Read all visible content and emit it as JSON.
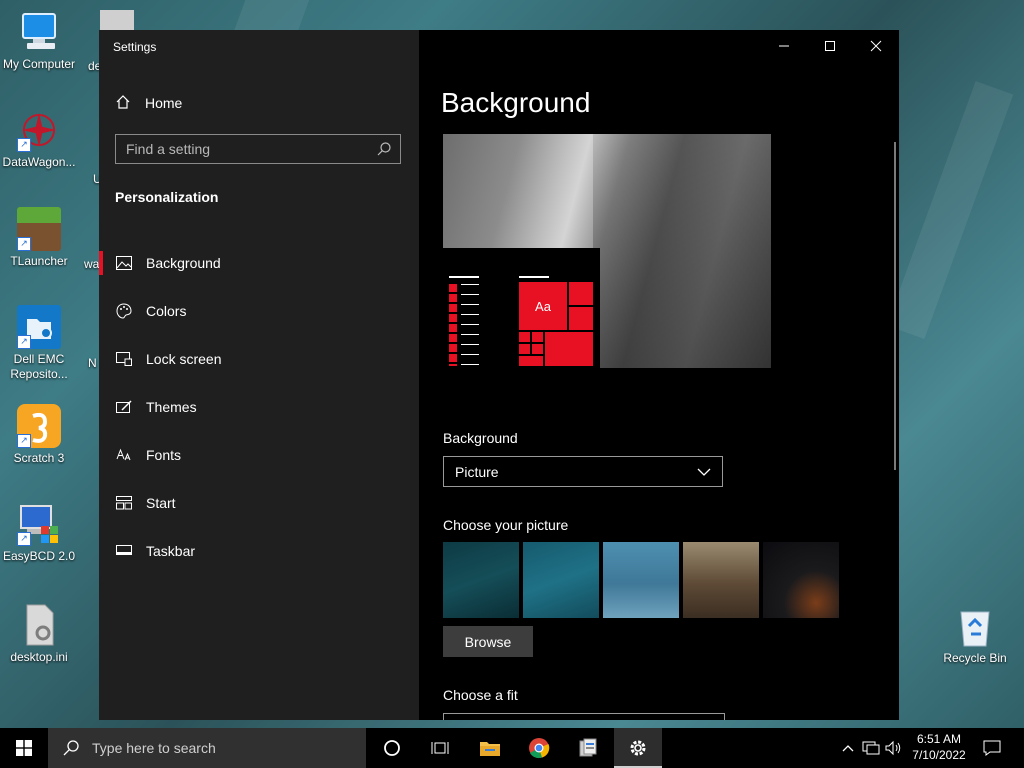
{
  "desktop": {
    "icons": [
      {
        "label_line1": "My Computer",
        "label_line2": ""
      },
      {
        "label_line1": "DataWagon...",
        "label_line2": ""
      },
      {
        "label_line1": "TLauncher",
        "label_line2": ""
      },
      {
        "label_line1": "Dell EMC",
        "label_line2": "Reposito..."
      },
      {
        "label_line1": "Scratch 3",
        "label_line2": ""
      },
      {
        "label_line1": "EasyBCD 2.0",
        "label_line2": ""
      },
      {
        "label_line1": "desktop.ini",
        "label_line2": ""
      },
      {
        "label_line1": "Recycle Bin",
        "label_line2": ""
      }
    ],
    "partial_labels": [
      "de",
      "U",
      "wa",
      "N"
    ]
  },
  "window": {
    "title": "Settings",
    "home_label": "Home",
    "search_placeholder": "Find a setting",
    "section": "Personalization",
    "nav": [
      {
        "label": "Background",
        "icon": "picture-icon"
      },
      {
        "label": "Colors",
        "icon": "palette-icon"
      },
      {
        "label": "Lock screen",
        "icon": "lock-screen-icon"
      },
      {
        "label": "Themes",
        "icon": "brush-icon"
      },
      {
        "label": "Fonts",
        "icon": "font-icon"
      },
      {
        "label": "Start",
        "icon": "start-menu-icon"
      },
      {
        "label": "Taskbar",
        "icon": "taskbar-icon"
      }
    ],
    "page_title": "Background",
    "preview_tile_text": "Aa",
    "background_label": "Background",
    "background_value": "Picture",
    "choose_picture_label": "Choose your picture",
    "browse_label": "Browse",
    "choose_fit_label": "Choose a fit"
  },
  "taskbar": {
    "search_placeholder": "Type here to search",
    "time": "6:51 AM",
    "date": "7/10/2022"
  },
  "colors": {
    "accent": "#e81123",
    "window_bg": "#000000",
    "sidebar_bg": "#1f1f1f"
  }
}
